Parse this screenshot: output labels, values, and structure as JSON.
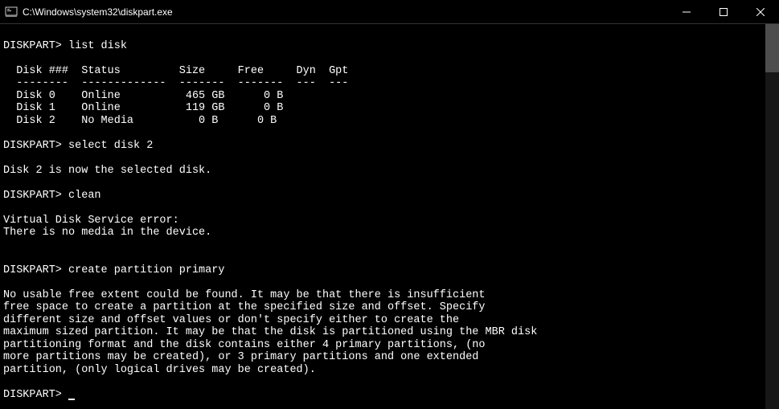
{
  "titlebar": {
    "title": "C:\\Windows\\system32\\diskpart.exe"
  },
  "terminal": {
    "prompt": "DISKPART>",
    "commands": {
      "cmd1": "list disk",
      "cmd2": "select disk 2",
      "cmd3": "clean",
      "cmd4": "create partition primary"
    },
    "table": {
      "header": "  Disk ###  Status         Size     Free     Dyn  Gpt",
      "divider": "  --------  -------------  -------  -------  ---  ---",
      "row0": "  Disk 0    Online          465 GB      0 B",
      "row1": "  Disk 1    Online          119 GB      0 B",
      "row2": "  Disk 2    No Media          0 B      0 B"
    },
    "messages": {
      "selected": "Disk 2 is now the selected disk.",
      "error_title": "Virtual Disk Service error:",
      "error_msg": "There is no media in the device.",
      "noext1": "No usable free extent could be found. It may be that there is insufficient",
      "noext2": "free space to create a partition at the specified size and offset. Specify",
      "noext3": "different size and offset values or don't specify either to create the",
      "noext4": "maximum sized partition. It may be that the disk is partitioned using the MBR disk",
      "noext5": "partitioning format and the disk contains either 4 primary partitions, (no",
      "noext6": "more partitions may be created), or 3 primary partitions and one extended",
      "noext7": "partition, (only logical drives may be created)."
    }
  }
}
